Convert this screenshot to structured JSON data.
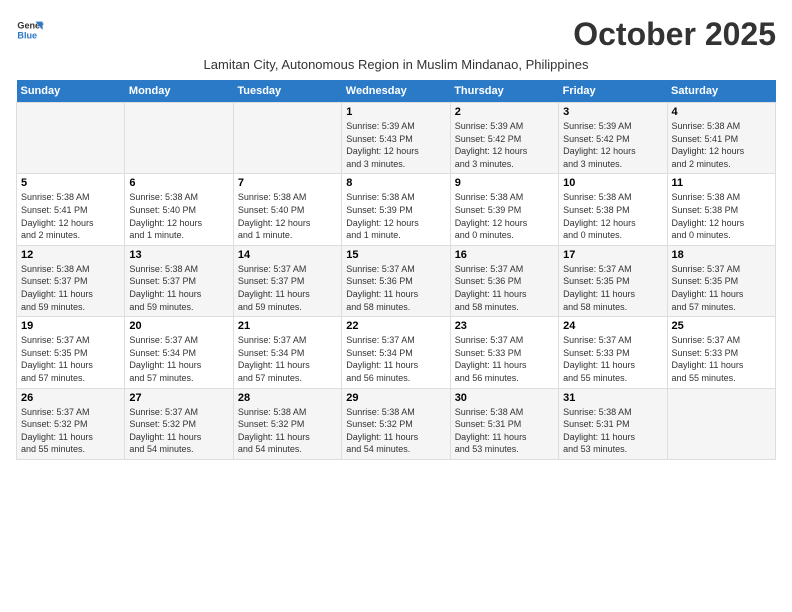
{
  "logo": {
    "line1": "General",
    "line2": "Blue"
  },
  "title": "October 2025",
  "subtitle": "Lamitan City, Autonomous Region in Muslim Mindanao, Philippines",
  "days_of_week": [
    "Sunday",
    "Monday",
    "Tuesday",
    "Wednesday",
    "Thursday",
    "Friday",
    "Saturday"
  ],
  "weeks": [
    [
      {
        "day": "",
        "info": ""
      },
      {
        "day": "",
        "info": ""
      },
      {
        "day": "",
        "info": ""
      },
      {
        "day": "1",
        "info": "Sunrise: 5:39 AM\nSunset: 5:43 PM\nDaylight: 12 hours\nand 3 minutes."
      },
      {
        "day": "2",
        "info": "Sunrise: 5:39 AM\nSunset: 5:42 PM\nDaylight: 12 hours\nand 3 minutes."
      },
      {
        "day": "3",
        "info": "Sunrise: 5:39 AM\nSunset: 5:42 PM\nDaylight: 12 hours\nand 3 minutes."
      },
      {
        "day": "4",
        "info": "Sunrise: 5:38 AM\nSunset: 5:41 PM\nDaylight: 12 hours\nand 2 minutes."
      }
    ],
    [
      {
        "day": "5",
        "info": "Sunrise: 5:38 AM\nSunset: 5:41 PM\nDaylight: 12 hours\nand 2 minutes."
      },
      {
        "day": "6",
        "info": "Sunrise: 5:38 AM\nSunset: 5:40 PM\nDaylight: 12 hours\nand 1 minute."
      },
      {
        "day": "7",
        "info": "Sunrise: 5:38 AM\nSunset: 5:40 PM\nDaylight: 12 hours\nand 1 minute."
      },
      {
        "day": "8",
        "info": "Sunrise: 5:38 AM\nSunset: 5:39 PM\nDaylight: 12 hours\nand 1 minute."
      },
      {
        "day": "9",
        "info": "Sunrise: 5:38 AM\nSunset: 5:39 PM\nDaylight: 12 hours\nand 0 minutes."
      },
      {
        "day": "10",
        "info": "Sunrise: 5:38 AM\nSunset: 5:38 PM\nDaylight: 12 hours\nand 0 minutes."
      },
      {
        "day": "11",
        "info": "Sunrise: 5:38 AM\nSunset: 5:38 PM\nDaylight: 12 hours\nand 0 minutes."
      }
    ],
    [
      {
        "day": "12",
        "info": "Sunrise: 5:38 AM\nSunset: 5:37 PM\nDaylight: 11 hours\nand 59 minutes."
      },
      {
        "day": "13",
        "info": "Sunrise: 5:38 AM\nSunset: 5:37 PM\nDaylight: 11 hours\nand 59 minutes."
      },
      {
        "day": "14",
        "info": "Sunrise: 5:37 AM\nSunset: 5:37 PM\nDaylight: 11 hours\nand 59 minutes."
      },
      {
        "day": "15",
        "info": "Sunrise: 5:37 AM\nSunset: 5:36 PM\nDaylight: 11 hours\nand 58 minutes."
      },
      {
        "day": "16",
        "info": "Sunrise: 5:37 AM\nSunset: 5:36 PM\nDaylight: 11 hours\nand 58 minutes."
      },
      {
        "day": "17",
        "info": "Sunrise: 5:37 AM\nSunset: 5:35 PM\nDaylight: 11 hours\nand 58 minutes."
      },
      {
        "day": "18",
        "info": "Sunrise: 5:37 AM\nSunset: 5:35 PM\nDaylight: 11 hours\nand 57 minutes."
      }
    ],
    [
      {
        "day": "19",
        "info": "Sunrise: 5:37 AM\nSunset: 5:35 PM\nDaylight: 11 hours\nand 57 minutes."
      },
      {
        "day": "20",
        "info": "Sunrise: 5:37 AM\nSunset: 5:34 PM\nDaylight: 11 hours\nand 57 minutes."
      },
      {
        "day": "21",
        "info": "Sunrise: 5:37 AM\nSunset: 5:34 PM\nDaylight: 11 hours\nand 57 minutes."
      },
      {
        "day": "22",
        "info": "Sunrise: 5:37 AM\nSunset: 5:34 PM\nDaylight: 11 hours\nand 56 minutes."
      },
      {
        "day": "23",
        "info": "Sunrise: 5:37 AM\nSunset: 5:33 PM\nDaylight: 11 hours\nand 56 minutes."
      },
      {
        "day": "24",
        "info": "Sunrise: 5:37 AM\nSunset: 5:33 PM\nDaylight: 11 hours\nand 55 minutes."
      },
      {
        "day": "25",
        "info": "Sunrise: 5:37 AM\nSunset: 5:33 PM\nDaylight: 11 hours\nand 55 minutes."
      }
    ],
    [
      {
        "day": "26",
        "info": "Sunrise: 5:37 AM\nSunset: 5:32 PM\nDaylight: 11 hours\nand 55 minutes."
      },
      {
        "day": "27",
        "info": "Sunrise: 5:37 AM\nSunset: 5:32 PM\nDaylight: 11 hours\nand 54 minutes."
      },
      {
        "day": "28",
        "info": "Sunrise: 5:38 AM\nSunset: 5:32 PM\nDaylight: 11 hours\nand 54 minutes."
      },
      {
        "day": "29",
        "info": "Sunrise: 5:38 AM\nSunset: 5:32 PM\nDaylight: 11 hours\nand 54 minutes."
      },
      {
        "day": "30",
        "info": "Sunrise: 5:38 AM\nSunset: 5:31 PM\nDaylight: 11 hours\nand 53 minutes."
      },
      {
        "day": "31",
        "info": "Sunrise: 5:38 AM\nSunset: 5:31 PM\nDaylight: 11 hours\nand 53 minutes."
      },
      {
        "day": "",
        "info": ""
      }
    ]
  ]
}
